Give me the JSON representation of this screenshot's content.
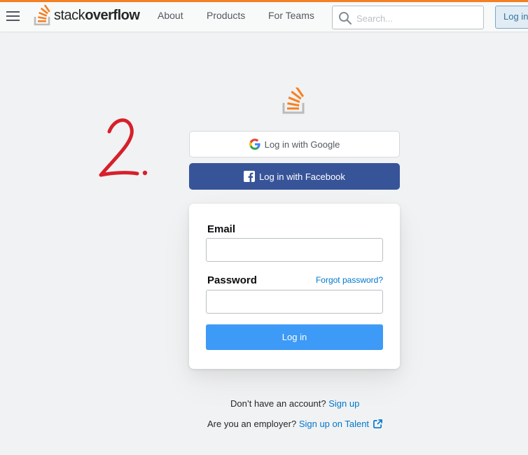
{
  "header": {
    "logo_text_light": "stack",
    "logo_text_bold": "overflow",
    "nav": [
      "About",
      "Products",
      "For Teams"
    ],
    "search_placeholder": "Search...",
    "login_label": "Log in"
  },
  "social": {
    "google_label": "Log in with Google",
    "facebook_label": "Log in with Facebook"
  },
  "form": {
    "email_label": "Email",
    "email_value": "",
    "password_label": "Password",
    "password_value": "",
    "forgot_label": "Forgot password?",
    "submit_label": "Log in"
  },
  "footer": {
    "signup_prompt": "Don’t have an account?",
    "signup_link": "Sign up",
    "employer_prompt": "Are you an employer?",
    "talent_link": "Sign up on Talent"
  },
  "colors": {
    "brand_orange": "#f48024",
    "facebook_blue": "#385499",
    "primary_blue": "#3d9af6",
    "link_blue": "#0077cc",
    "annotation_red": "#d6202a"
  }
}
